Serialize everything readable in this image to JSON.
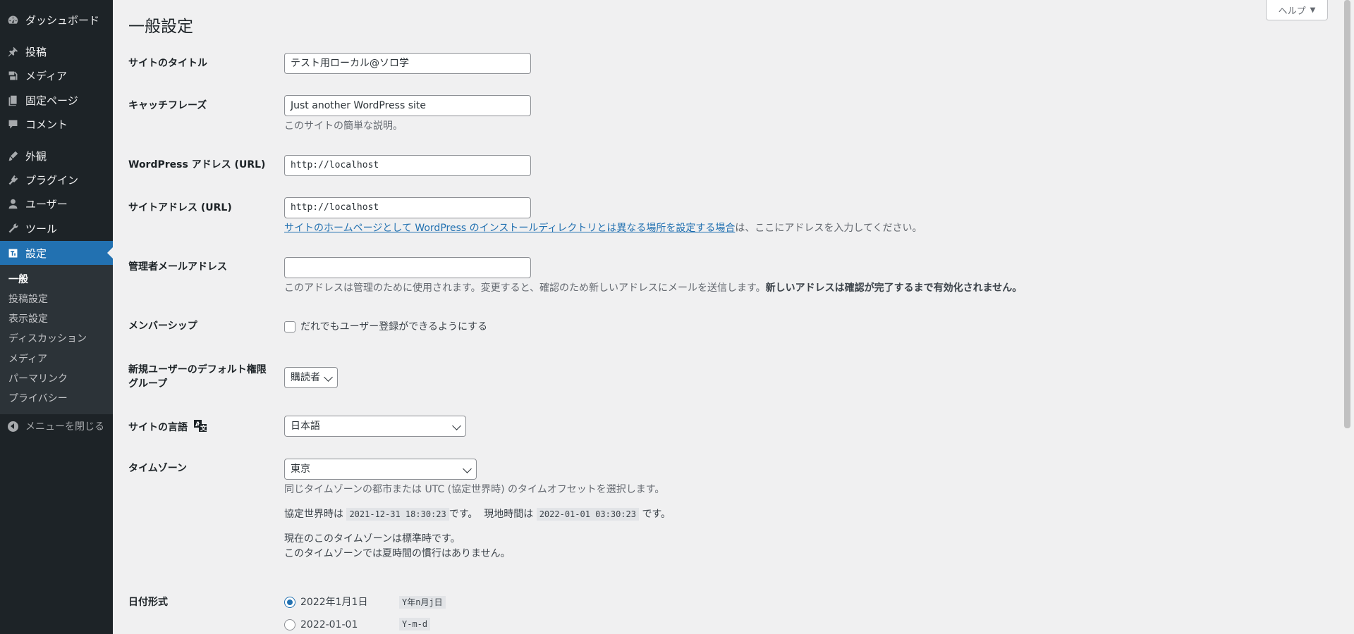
{
  "sidebar": {
    "items": [
      {
        "label": "ダッシュボード",
        "icon": "dashboard-icon"
      },
      {
        "label": "投稿",
        "icon": "pin-icon"
      },
      {
        "label": "メディア",
        "icon": "media-icon"
      },
      {
        "label": "固定ページ",
        "icon": "pages-icon"
      },
      {
        "label": "コメント",
        "icon": "comment-icon"
      },
      {
        "label": "外観",
        "icon": "appearance-icon"
      },
      {
        "label": "プラグイン",
        "icon": "plugin-icon"
      },
      {
        "label": "ユーザー",
        "icon": "user-icon"
      },
      {
        "label": "ツール",
        "icon": "wrench-icon"
      },
      {
        "label": "設定",
        "icon": "settings-icon"
      }
    ],
    "submenu": [
      "一般",
      "投稿設定",
      "表示設定",
      "ディスカッション",
      "メディア",
      "パーマリンク",
      "プライバシー"
    ],
    "collapse_label": "メニューを閉じる",
    "active_color": "#2271b1"
  },
  "header": {
    "title": "一般設定",
    "help_label": "ヘルプ"
  },
  "form": {
    "site_title": {
      "label": "サイトのタイトル",
      "value": "テスト用ローカル@ソロ学"
    },
    "tagline": {
      "label": "キャッチフレーズ",
      "value": "Just another WordPress site",
      "desc": "このサイトの簡単な説明。"
    },
    "wp_address": {
      "label": "WordPress アドレス (URL)",
      "value": "http://localhost"
    },
    "site_address": {
      "label": "サイトアドレス (URL)",
      "value": "http://localhost",
      "desc_link": "サイトのホームページとして WordPress のインストールディレクトリとは異なる場所を設定する場合",
      "desc_rest": "は、ここにアドレスを入力してください。"
    },
    "admin_email": {
      "label": "管理者メールアドレス",
      "value": "",
      "desc": "このアドレスは管理のために使用されます。変更すると、確認のため新しいアドレスにメールを送信します。",
      "desc_strong": "新しいアドレスは確認が完了するまで有効化されません。"
    },
    "membership": {
      "label": "メンバーシップ",
      "checkbox_label": "だれでもユーザー登録ができるようにする",
      "checked": false
    },
    "default_role": {
      "label_line1": "新規ユーザーのデフォルト権限",
      "label_line2": "グループ",
      "value": "購読者"
    },
    "language": {
      "label": "サイトの言語",
      "icon": "translate-icon",
      "value": "日本語"
    },
    "timezone": {
      "label": "タイムゾーン",
      "value": "東京",
      "desc": "同じタイムゾーンの都市または UTC (協定世界時) のタイムオフセットを選択します。",
      "utc_prefix": "協定世界時は",
      "utc_time": "2021-12-31 18:30:23",
      "utc_suffix": "です。",
      "local_prefix": "現地時間は",
      "local_time": "2022-01-01 03:30:23",
      "local_suffix": "です。",
      "std_line1": "現在のこのタイムゾーンは標準時です。",
      "std_line2": "このタイムゾーンでは夏時間の慣行はありません。"
    },
    "date_format": {
      "label": "日付形式",
      "options": [
        {
          "label": "2022年1月1日",
          "code": "Y年n月j日",
          "checked": true
        },
        {
          "label": "2022-01-01",
          "code": "Y-m-d",
          "checked": false
        }
      ]
    }
  }
}
